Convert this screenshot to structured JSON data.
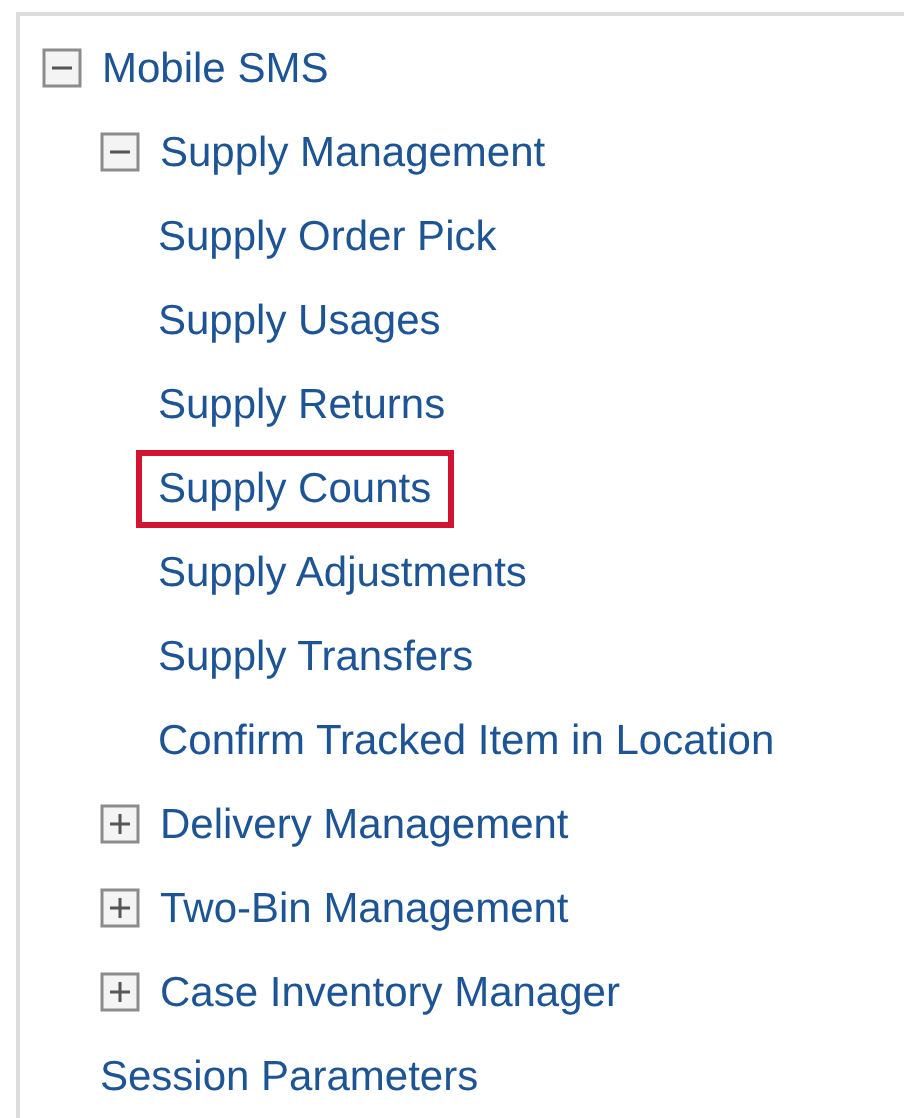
{
  "tree": [
    {
      "label": "Mobile SMS",
      "expanded": true,
      "highlighted": false,
      "children": [
        {
          "label": "Supply Management",
          "expanded": true,
          "highlighted": false,
          "children": [
            {
              "label": "Supply Order Pick",
              "highlighted": false
            },
            {
              "label": "Supply Usages",
              "highlighted": false
            },
            {
              "label": "Supply Returns",
              "highlighted": false
            },
            {
              "label": "Supply Counts",
              "highlighted": true
            },
            {
              "label": "Supply Adjustments",
              "highlighted": false
            },
            {
              "label": "Supply Transfers",
              "highlighted": false
            },
            {
              "label": "Confirm Tracked Item in Location",
              "highlighted": false
            }
          ]
        },
        {
          "label": "Delivery Management",
          "expanded": false,
          "highlighted": false
        },
        {
          "label": "Two-Bin Management",
          "expanded": false,
          "highlighted": false
        },
        {
          "label": "Case Inventory Manager",
          "expanded": false,
          "highlighted": false
        },
        {
          "label": "Session Parameters",
          "highlighted": false
        }
      ]
    }
  ]
}
